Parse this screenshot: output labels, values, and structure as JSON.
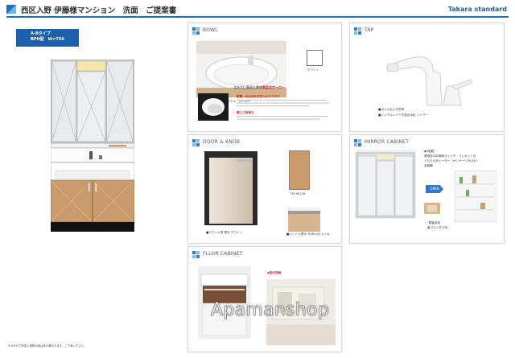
{
  "header": {
    "title": "西区入野 伊藤様マンション　洗面　ご提案書",
    "brand": "Takara standard"
  },
  "model": {
    "type_line": "A-Bタイプ",
    "size_line": "BPH型　W=750"
  },
  "cards": {
    "bowl": {
      "title": "BOWL",
      "swatch_label": "ホワイト",
      "product_label": "ボウル一体型・樹脂製ボウル　ホーロー",
      "feature_heading_1": "丈夫さに最適な素材",
      "feature_heading_1_em": "高品位ホーロー",
      "feature_heading_2": "耐傷・水はねもお手入れラクラク",
      "feature_heading_3": "美しさ長持ち"
    },
    "tap": {
      "title": "TAP",
      "spec_1": "■ボトル払い式洗浄",
      "spec_2": "■シングルレバー式混合水栓 シャワー"
    },
    "door": {
      "title": "DOOR & KNOB",
      "swatch_code": "TYP-9K126",
      "caption_left": "■ラウンド型 把手 ホワイト",
      "caption_right": "■ハンドル把手 TLMB-9K メッキ"
    },
    "mirror": {
      "title": "MIRROR CABINET",
      "spec_1": "◆3面鏡",
      "spec_2": "電球型LED照明スイッチ・コンセント付",
      "spec_3": "くもり止めヒーター（センサーつきLED）",
      "spec_4": "収納棚",
      "spec_5": "・鏡裏収納",
      "spec_6": "裏プラン左で対",
      "badge": "OPEN"
    },
    "floor": {
      "title": "FLLOR CABINET",
      "spec_1": "◆足元収納"
    }
  },
  "footnote": "※カタログ写真と実物の色は多少異なります。ご了承ください。",
  "watermark": "Apamanshop",
  "colors": {
    "brand_blue": "#1d5fa8",
    "accent_red": "#d4161c",
    "wood": "#c89a6c"
  }
}
